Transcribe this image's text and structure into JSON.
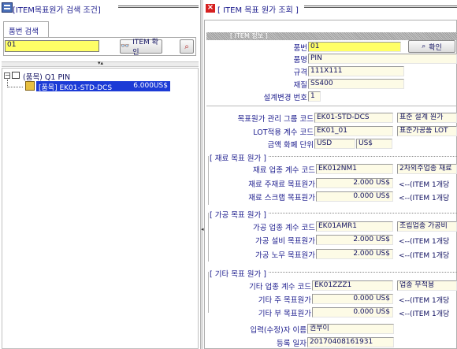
{
  "left_panel": {
    "title": "[ITEM목표원가 검색 조건]",
    "tab_label": "품번 검색",
    "search_value": "01",
    "confirm_button": "ITEM 확인",
    "tree": {
      "root_label": "(품목) Q1 PIN",
      "child_label": "[품목] EK01-STD-DCS",
      "child_amount": "6.000US$"
    }
  },
  "right_panel": {
    "title": "[ ITEM 목표 원가 조회 ]",
    "section_label": "[ ITEM 정보 ]",
    "item_info": {
      "part_no_label": "품번",
      "part_no": "01",
      "confirm_button": "확인",
      "part_name_label": "품명",
      "part_name": "PIN",
      "spec_label": "규격",
      "spec": "111X111",
      "material_label": "재질",
      "material": "SS400",
      "design_change_label": "설계변경 번호",
      "design_change": "1"
    },
    "cost_info": {
      "group_code_label": "목표원가 관리 그룹 코드",
      "group_code": "EK01-STD-DCS",
      "group_note": "표준 설계 원가 ",
      "lot_code_label": "LOT적용 계수 코드",
      "lot_code": "EK01_01",
      "lot_note": "표준가공품 LOT ",
      "currency_label": "금액 화폐 단위",
      "currency": "USD",
      "currency_unit": "US$"
    },
    "material": {
      "title": "[ 재료 목표 원가 ]",
      "code_label": "재료 업종 계수 코드",
      "code": "EK012NM1",
      "code_note": "2차외주업종 재료",
      "main_label": "재료 주재료 목표원가",
      "main_value": "2.000 US$",
      "main_note": "<--(ITEM 1개당",
      "scrap_label": "재료 스크랩 목표원가",
      "scrap_value": "0.000 US$",
      "scrap_note": "<--(ITEM 1개당"
    },
    "processing": {
      "title": "[ 가공 목표 원가 ]",
      "code_label": "가공 업종 계수 코드",
      "code": "EK01AMR1",
      "code_note": "조립업종 가공비",
      "equip_label": "가공 설비 목표원가",
      "equip_value": "2.000 US$",
      "equip_note": "<--(ITEM 1개당",
      "labor_label": "가공 노무 목표원가",
      "labor_value": "2.000 US$",
      "labor_note": "<--(ITEM 1개당"
    },
    "other": {
      "title": "[ 기타 목표 원가 ]",
      "code_label": "기타 업종 계수 코드",
      "code": "EK01ZZZ1",
      "code_note": "업종 무적용",
      "main_label": "기타 주 목표원가",
      "main_value": "0.000 US$",
      "main_note": "<--(ITEM 1개당",
      "sub_label": "기타 부 목표원가",
      "sub_value": "0.000 US$",
      "sub_note": "<--(ITEM 1개당"
    },
    "footer": {
      "editor_label": "입력(수정)자 이름",
      "editor": "권부이",
      "date_label": "등록 일자",
      "date": "20170408161931"
    }
  },
  "colors": {
    "label_text": "#1a1a8c",
    "field_bg": "#fdfbe6",
    "input_highlight": "#ffff66",
    "tree_selection": "#1c3bd6",
    "close_red": "#d62020"
  }
}
